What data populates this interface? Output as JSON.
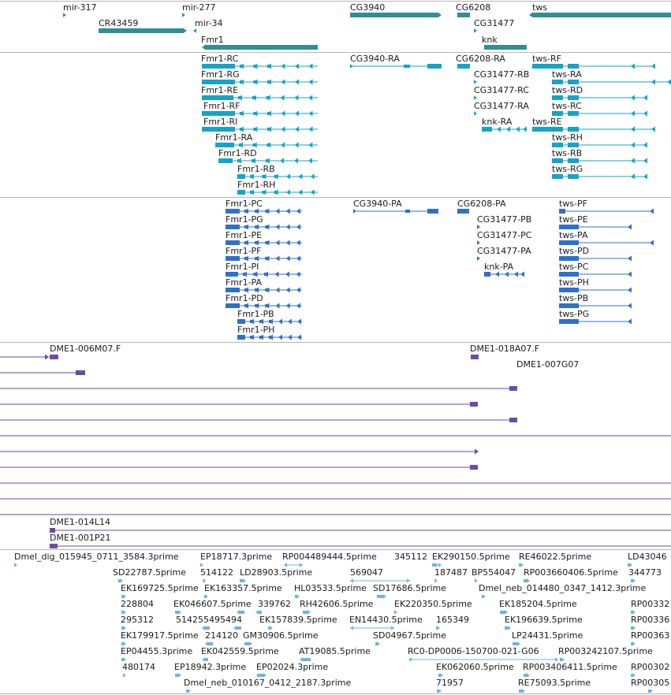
{
  "colors": {
    "gene": "#2e8f95",
    "mrna": "#13a5c8",
    "protein": "#2f6fcf",
    "clone": "#6e4aa8",
    "est": "#6fb3e0",
    "separator": "#b5b5b5"
  },
  "gene_track": {
    "genes": [
      "mir-317",
      "mir-277",
      "CG3940",
      "CG6208",
      "tws",
      "CR43459",
      "mir-34",
      "CG31477",
      "Fmr1",
      "knk"
    ]
  },
  "mrna_track": {
    "transcripts": [
      "Fmr1-RC",
      "CG3940-RA",
      "CG6208-RA",
      "tws-RF",
      "Fmr1-RG",
      "CG31477-RB",
      "tws-RA",
      "Fmr1-RE",
      "CG31477-RC",
      "tws-RD",
      "Fmr1-RF",
      "CG31477-RA",
      "tws-RC",
      "Fmr1-RI",
      "knk-RA",
      "tws-RE",
      "Fmr1-RA",
      "tws-RH",
      "Fmr1-RD",
      "tws-RB",
      "Fmr1-RB",
      "tws-RG",
      "Fmr1-RH"
    ]
  },
  "protein_track": {
    "proteins": [
      "Fmr1-PC",
      "CG3940-PA",
      "CG6208-PA",
      "tws-PF",
      "Fmr1-PG",
      "CG31477-PB",
      "tws-PE",
      "Fmr1-PE",
      "CG31477-PC",
      "tws-PA",
      "Fmr1-PF",
      "CG31477-PA",
      "tws-PD",
      "Fmr1-PI",
      "knk-PA",
      "tws-PC",
      "Fmr1-PA",
      "tws-PH",
      "Fmr1-PD",
      "tws-PB",
      "Fmr1-PB",
      "tws-PG",
      "Fmr1-PH"
    ]
  },
  "clone_track": {
    "clones": [
      "DME1-006M07.F",
      "DME1-018A07.F",
      "DME1-007G07",
      "DME1-014L14",
      "DME1-001P21"
    ]
  },
  "est_track": {
    "ests": [
      "Dmel_dig_015945_0711_3584.3prime",
      "EP18717.3prime",
      "RP004489444.5prime",
      "345112",
      "EK290150.5prime",
      "RE46022.5prime",
      "LD43046",
      "SD22787.5prime",
      "514122",
      "LD28903.5prime",
      "569047",
      "187487",
      "BP554047",
      "RP003660406.5prime",
      "344773",
      "EK169725.5prime",
      "EK163357.5prime",
      "HL03533.5prime",
      "SD17686.5prime",
      "Dmel_neb_014480_0347_1412.3prime",
      "228804",
      "EK046607.5prime",
      "339762",
      "RH42606.5prime",
      "EK220350.5prime",
      "EK185204.5prime",
      "RP00332",
      "295312",
      "514255495494",
      "EK157839.5prime",
      "EN14430.5prime",
      "165349",
      "EK196639.5prime",
      "RP00336",
      "EK179917.5prime",
      "214120",
      "GM30906.5prime",
      "SD04967.5prime",
      "LP24431.5prime",
      "RP00363",
      "EP04455.3prime",
      "EK042559.5prime",
      "AT19085.5prime",
      "RC0-DP0006-150700-021-G06",
      "RP003242107.5prime",
      "480174",
      "EP18942.3prime",
      "EP02024.3prime",
      "EK062060.5prime",
      "RP003406411.5prime",
      "RP00302",
      "Dmel_neb_010167_0412_2187.3prime",
      "71957",
      "RE75093.5prime",
      "RP00305"
    ]
  }
}
